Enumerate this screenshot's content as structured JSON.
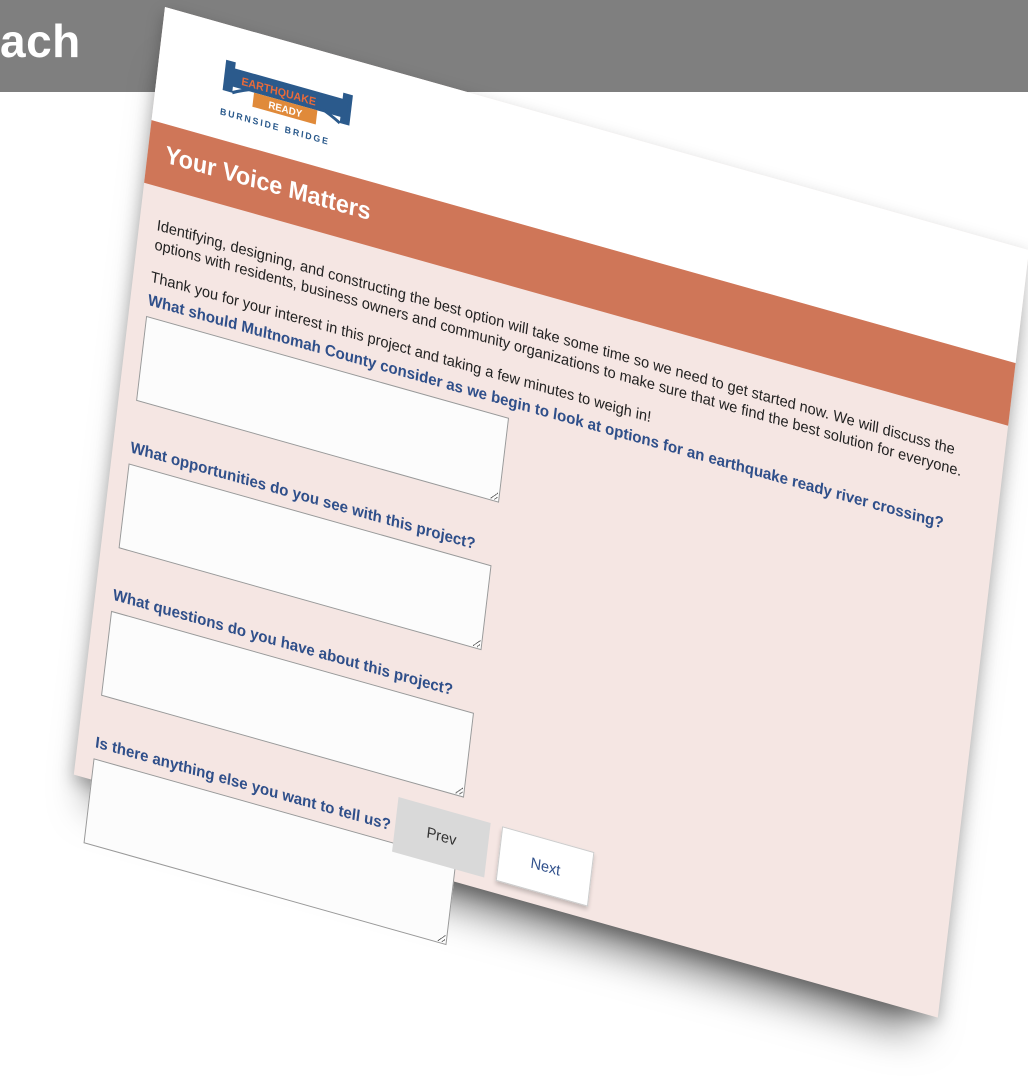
{
  "slide": {
    "title": "ach"
  },
  "logo": {
    "line1": "EARTHQUAKE",
    "line2": "READY",
    "line3": "BURNSIDE BRIDGE"
  },
  "form": {
    "banner_title": "Your Voice Matters",
    "intro": "Identifying, designing, and constructing the best option will take some time so we need to get started now. We will discuss the options with residents, business owners and community organizations to make sure that we find the best solution for everyone.",
    "thanks": "Thank you for your interest in this project and taking a few minutes to weigh in!",
    "questions": [
      {
        "label": "What should Multnomah County consider as we begin to look at options for an earthquake ready river crossing?",
        "value": ""
      },
      {
        "label": "What opportunities do you see with this project?",
        "value": ""
      },
      {
        "label": "What questions do you have about this project?",
        "value": ""
      },
      {
        "label": "Is there anything else you want to tell us?",
        "value": ""
      }
    ],
    "prev_label": "Prev",
    "next_label": "Next"
  },
  "colors": {
    "banner": "#cf7658",
    "form_bg": "#f5e6e3",
    "question_text": "#2f4f8a",
    "slide_header": "#7f7f7f"
  }
}
